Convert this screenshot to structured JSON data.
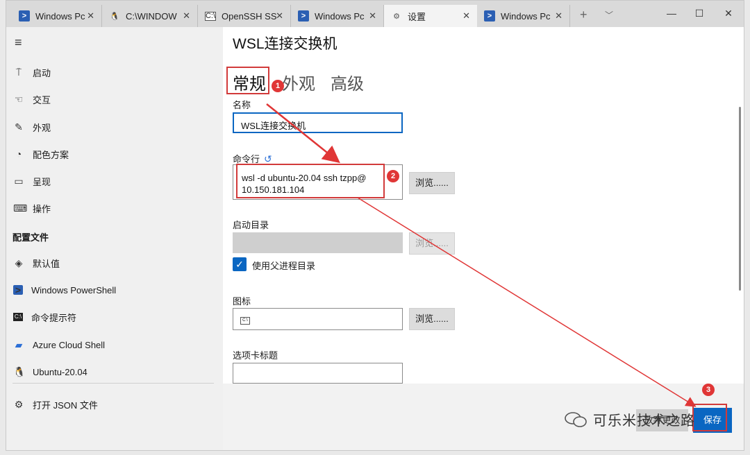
{
  "tabs": [
    {
      "title": "Windows Pc",
      "icon": "powershell-icon"
    },
    {
      "title": "C:\\WINDOW",
      "icon": "linux-penguin-icon"
    },
    {
      "title": "OpenSSH SS",
      "icon": "command-prompt-icon"
    },
    {
      "title": "Windows Pc",
      "icon": "powershell-icon"
    },
    {
      "title": "设置",
      "icon": "gear-icon"
    },
    {
      "title": "Windows Pc",
      "icon": "powershell-icon"
    }
  ],
  "sidebar": {
    "items": [
      {
        "label": "启动",
        "icon": "startup-icon"
      },
      {
        "label": "交互",
        "icon": "interaction-icon"
      },
      {
        "label": "外观",
        "icon": "appearance-icon"
      },
      {
        "label": "配色方案",
        "icon": "palette-icon"
      },
      {
        "label": "呈现",
        "icon": "rendering-icon"
      },
      {
        "label": "操作",
        "icon": "keyboard-icon"
      }
    ],
    "section_title": "配置文件",
    "profiles": [
      {
        "label": "默认值",
        "icon": "layers-icon"
      },
      {
        "label": "Windows PowerShell",
        "icon": "powershell-icon"
      },
      {
        "label": "命令提示符",
        "icon": "command-prompt-icon"
      },
      {
        "label": "Azure Cloud Shell",
        "icon": "azure-icon"
      },
      {
        "label": "Ubuntu-20.04",
        "icon": "linux-penguin-icon"
      }
    ],
    "open_json": "打开 JSON 文件"
  },
  "main": {
    "title": "WSL连接交换机",
    "subtabs": [
      "常规",
      "外观",
      "高级"
    ],
    "name_label": "名称",
    "name_value": "WSL连接交换机",
    "cmd_label": "命令行",
    "cmd_line1": "wsl -d ubuntu-20.04 ssh tzpp@",
    "cmd_line2": "10.150.181.104",
    "browse_label": "浏览......",
    "startdir_label": "启动目录",
    "startdir_browse": "浏览......",
    "use_parent_label": "使用父进程目录",
    "icon_label": "图标",
    "icon_browse": "浏览......",
    "tabtitle_label": "选项卡标题"
  },
  "footer": {
    "discard_label": "放弃更改",
    "save_label": "保存"
  },
  "annotations": [
    "1",
    "2",
    "3"
  ],
  "watermark": "可乐米技术之路"
}
